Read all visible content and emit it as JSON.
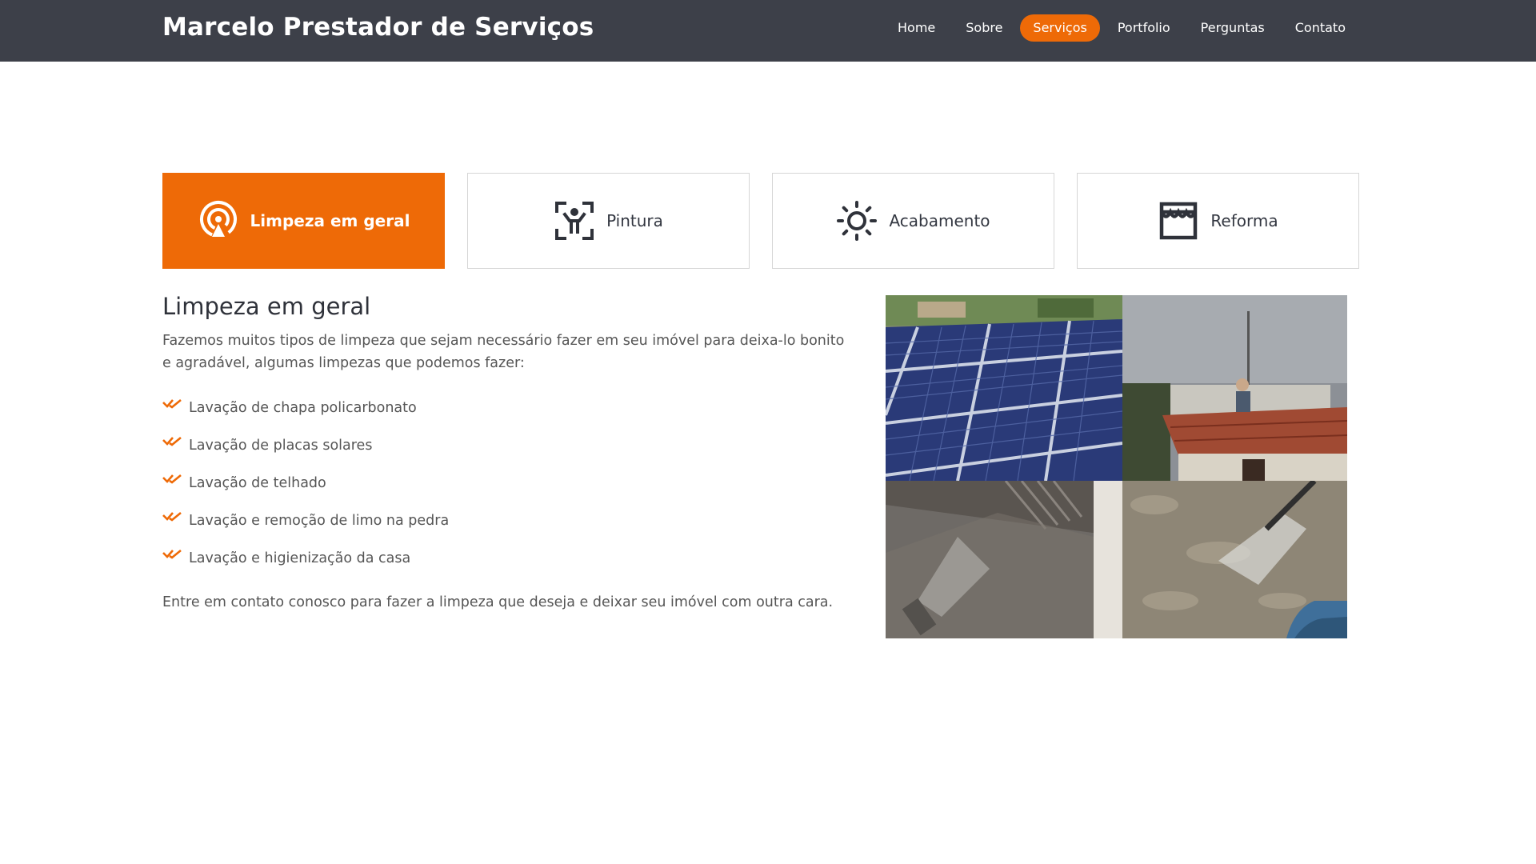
{
  "header": {
    "brand": "Marcelo Prestador de Serviços",
    "nav": [
      {
        "label": "Home"
      },
      {
        "label": "Sobre"
      },
      {
        "label": "Serviços",
        "active": true
      },
      {
        "label": "Portfolio"
      },
      {
        "label": "Perguntas"
      },
      {
        "label": "Contato"
      }
    ]
  },
  "tabs": [
    {
      "label": "Limpeza em geral",
      "icon": "broadcast-icon",
      "active": true
    },
    {
      "label": "Pintura",
      "icon": "person-scan-icon"
    },
    {
      "label": "Acabamento",
      "icon": "sun-icon"
    },
    {
      "label": "Reforma",
      "icon": "storefront-icon"
    }
  ],
  "service": {
    "title": "Limpeza em geral",
    "intro": "Fazemos muitos tipos de limpeza que sejam necessário fazer em seu imóvel para deixa-lo bonito e agradável, algumas limpezas que podemos fazer:",
    "items": [
      "Lavação de chapa policarbonato",
      "Lavação de placas solares",
      "Lavação de telhado",
      "Lavação e remoção de limo na pedra",
      "Lavação e higienização da casa"
    ],
    "outro": "Entre em contato conosco para fazer a limpeza que deseja e deixar seu imóvel com outra cara."
  },
  "photos": [
    {
      "subject": "solar-panels"
    },
    {
      "subject": "roof-washing"
    },
    {
      "subject": "polycarbonate-washing"
    },
    {
      "subject": "stone-washing"
    }
  ],
  "colors": {
    "accent": "#ee6a07",
    "header_bg": "#3d4049",
    "text": "#555555",
    "heading": "#2f323a"
  }
}
